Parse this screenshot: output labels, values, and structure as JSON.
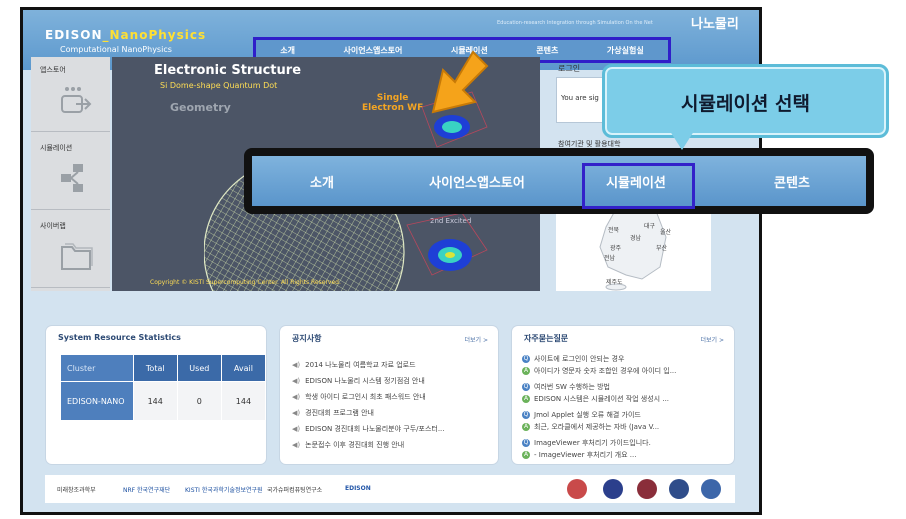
{
  "header": {
    "logo_text": "EDISON",
    "logo_highlight": "_NanoPhysics",
    "logo_subtitle": "Computational NanoPhysics",
    "tagline": "Education-research Integration through Simulation On the Net",
    "site_title": "나노물리",
    "nav": [
      "소개",
      "사이언스앱스토어",
      "시뮬레이션",
      "콘텐츠",
      "가상실험실"
    ]
  },
  "sidebar": {
    "items": [
      {
        "label": "앱스토어",
        "icon": "app-store-icon"
      },
      {
        "label": "시뮬레이션",
        "icon": "simulation-icon"
      },
      {
        "label": "사이버랩",
        "icon": "folder-icon"
      }
    ]
  },
  "hero": {
    "title": "Electronic Structure",
    "subtitle": "Si Dome-shape Quantum Dot",
    "geometry": "Geometry",
    "wf_line1": "Single",
    "wf_line2": "Electron WF",
    "excited": "2nd Excited",
    "copyright": "Copyright © KISTI Supercomputing Center. All Rights Reserved."
  },
  "login": {
    "title": "로그인",
    "text": "You are sig",
    "participating": "참여기관 및 활용대학"
  },
  "map": {
    "regions": [
      "대구",
      "울산",
      "경남",
      "부산",
      "전북",
      "광주",
      "전남",
      "제주도"
    ]
  },
  "callout": {
    "text": "시뮬레이션 선택",
    "color": "#7ccde8"
  },
  "zoom_nav": {
    "items": [
      "소개",
      "사이언스앱스토어",
      "시뮬레이션",
      "콘텐츠"
    ],
    "selected": "시뮬레이션"
  },
  "resources": {
    "title": "System Resource Statistics",
    "headers": [
      "Cluster",
      "Total",
      "Used",
      "Avail"
    ],
    "rows": [
      {
        "cluster": "EDISON-NANO",
        "total": "144",
        "used": "0",
        "avail": "144"
      }
    ]
  },
  "notices": {
    "title": "공지사항",
    "more": "더보기 >",
    "items": [
      "2014 나노물리 여름학교 자료 업로드",
      "EDISON 나노물리 시스템 정기점검 안내",
      "학생 아이디 로그인시 최초 패스워드 안내",
      "경진대회 프로그램 안내",
      "EDISON 경진대회 나노물리분야 구두/포스터...",
      "논문접수 이후 경진대회 진행 안내"
    ]
  },
  "faq": {
    "title": "자주묻는질문",
    "more": "더보기 >",
    "items": [
      {
        "type": "Q",
        "text": "사이트에 로그인이 안되는 경우"
      },
      {
        "type": "A",
        "text": "아이디가 영문자 숫자 조합인 경우에 아이디 입..."
      },
      {
        "type": "Q",
        "text": "여러번 SW 수행하는 방법"
      },
      {
        "type": "A",
        "text": "EDISON 시스템은 시뮬레이션 작업 생성시 ..."
      },
      {
        "type": "Q",
        "text": "Jmol Applet 실행 오류 해결 가이드"
      },
      {
        "type": "A",
        "text": "최근, 오라클에서 제공하는 자바 (Java V..."
      },
      {
        "type": "Q",
        "text": "ImageViewer 후처리기 가이드입니다."
      },
      {
        "type": "A",
        "text": "- ImageViewer 후처리기 개요 ..."
      }
    ]
  },
  "footer": {
    "partners": [
      "미래창조과학부",
      "NRF 한국연구재단",
      "KISTI 한국과학기술정보연구원",
      "국가슈퍼컴퓨팅연구소",
      "EDISON"
    ]
  }
}
